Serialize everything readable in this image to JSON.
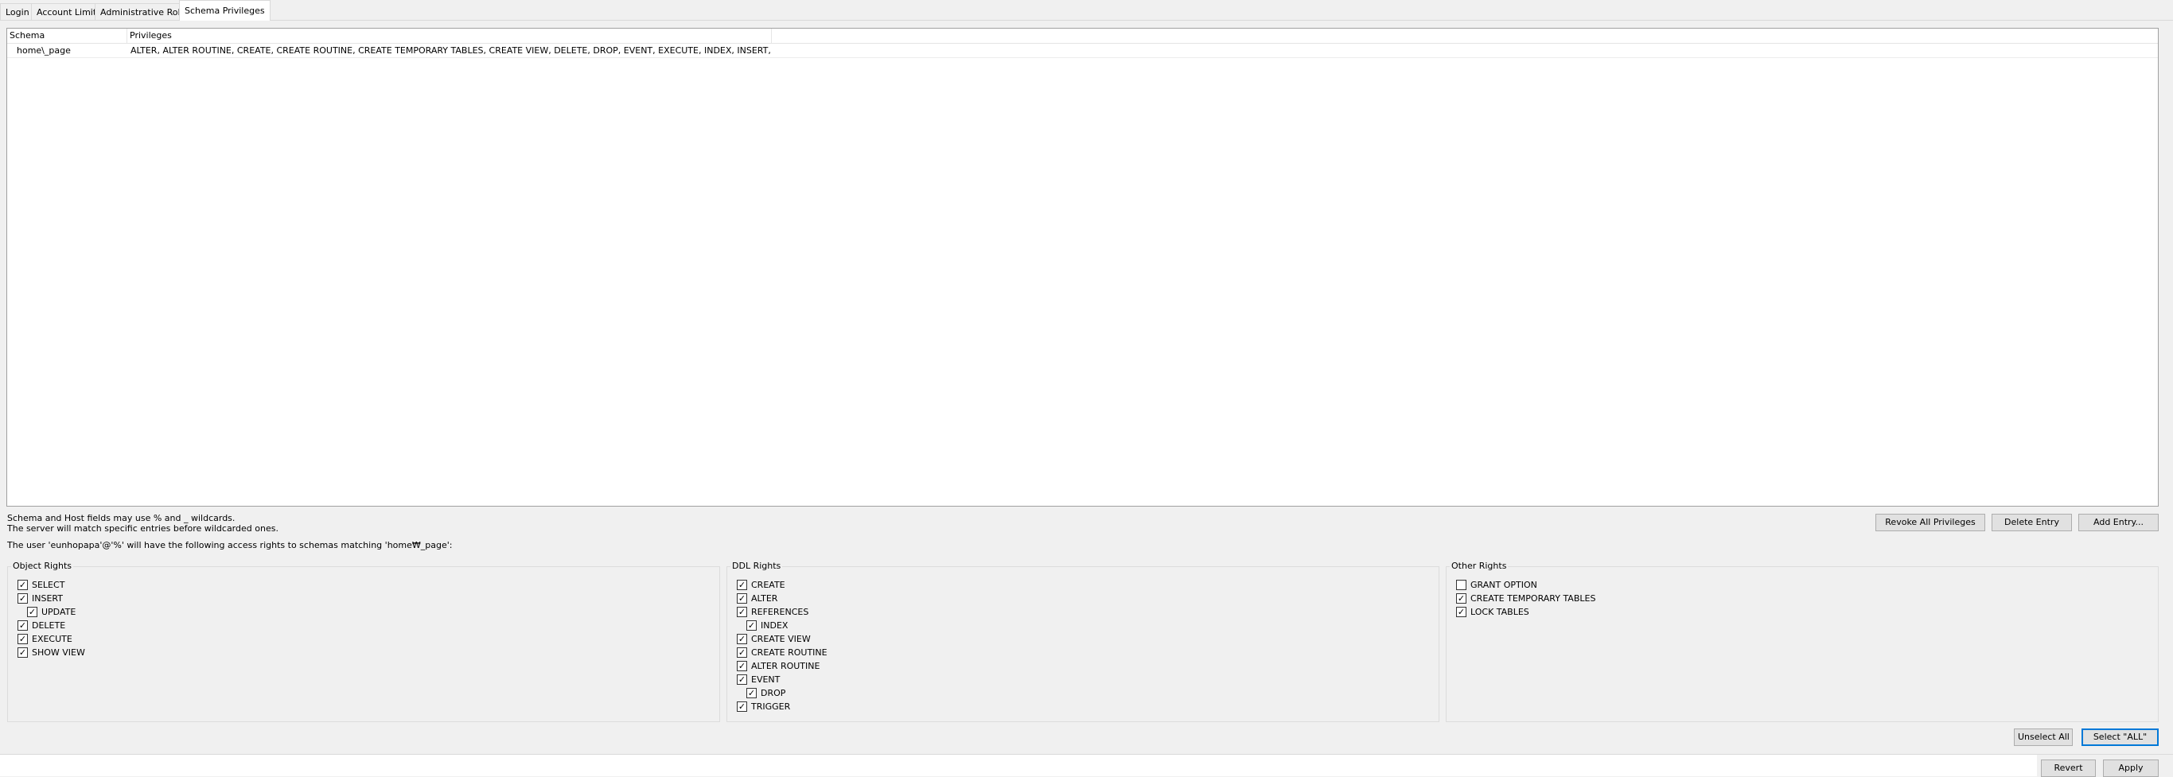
{
  "tabs": [
    {
      "label": "Login"
    },
    {
      "label": "Account Limits"
    },
    {
      "label": "Administrative Roles"
    },
    {
      "label": "Schema Privileges"
    }
  ],
  "grid": {
    "columns": [
      "Schema",
      "Privileges"
    ],
    "rows": [
      {
        "schema": "home\\_page",
        "privileges": "ALTER, ALTER ROUTINE, CREATE, CREATE ROUTINE, CREATE TEMPORARY TABLES, CREATE VIEW, DELETE, DROP, EVENT, EXECUTE, INDEX, INSERT, LO..."
      }
    ]
  },
  "info": {
    "line1": "Schema and Host fields may use % and _ wildcards.",
    "line2": "The server will match specific entries before wildcarded ones.",
    "access": "The user 'eunhopapa'@'%' will have the following access rights to schemas matching 'home₩_page':"
  },
  "actions": {
    "revoke_all": "Revoke All Privileges",
    "delete_entry": "Delete Entry",
    "add_entry": "Add Entry..."
  },
  "groups": {
    "object": {
      "title": "Object Rights",
      "items": [
        {
          "label": "SELECT",
          "checked": true
        },
        {
          "label": "INSERT",
          "checked": true
        },
        {
          "label": "UPDATE",
          "checked": true
        },
        {
          "label": "DELETE",
          "checked": true
        },
        {
          "label": "EXECUTE",
          "checked": true
        },
        {
          "label": "SHOW VIEW",
          "checked": true
        }
      ]
    },
    "ddl": {
      "title": "DDL Rights",
      "items": [
        {
          "label": "CREATE",
          "checked": true
        },
        {
          "label": "ALTER",
          "checked": true
        },
        {
          "label": "REFERENCES",
          "checked": true
        },
        {
          "label": "INDEX",
          "checked": true
        },
        {
          "label": "CREATE VIEW",
          "checked": true
        },
        {
          "label": "CREATE ROUTINE",
          "checked": true
        },
        {
          "label": "ALTER ROUTINE",
          "checked": true
        },
        {
          "label": "EVENT",
          "checked": true
        },
        {
          "label": "DROP",
          "checked": true
        },
        {
          "label": "TRIGGER",
          "checked": true
        }
      ]
    },
    "other": {
      "title": "Other Rights",
      "items": [
        {
          "label": "GRANT OPTION",
          "checked": false
        },
        {
          "label": "CREATE TEMPORARY TABLES",
          "checked": true
        },
        {
          "label": "LOCK TABLES",
          "checked": true
        }
      ]
    }
  },
  "selection": {
    "unselect_all": "Unselect All",
    "select_all": "Select \"ALL\""
  },
  "footer": {
    "revert": "Revert",
    "apply": "Apply"
  },
  "colors": {
    "accent": "#0078d7",
    "window_bg": "#f0f0f0"
  }
}
